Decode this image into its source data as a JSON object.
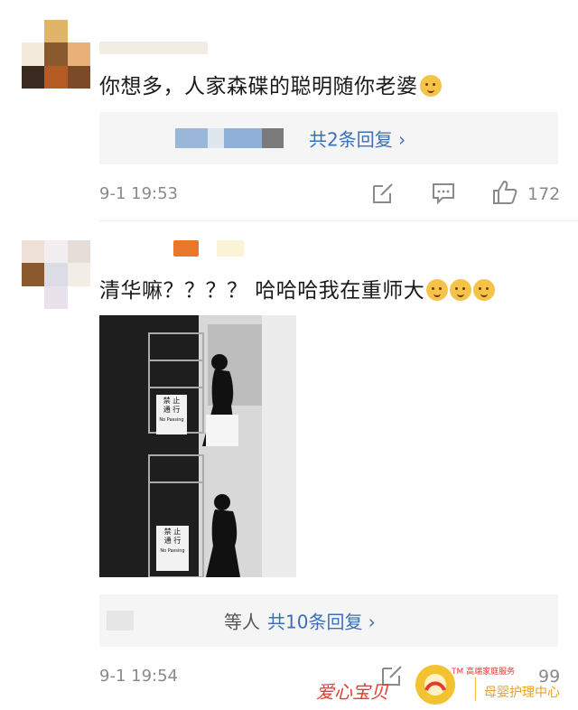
{
  "comments": [
    {
      "text": "你想多，人家森碟的聪明随你老婆",
      "replies_link": "共2条回复 ›",
      "time": "9-1 19:53",
      "like_count": "172"
    },
    {
      "text": "清华嘛？？？？ 哈哈哈我在重师大",
      "photo_signs": {
        "sign1": "禁 止\n通 行",
        "sign1_en": "No Passing"
      },
      "replies_prefix": "等人",
      "replies_link": "共10条回复 ›",
      "time": "9-1 19:54",
      "like_count": "99"
    }
  ],
  "watermark": {
    "left_text": "爱心宝贝",
    "tm_text": "TM 高端家庭服务",
    "right_text": "母婴护理中心"
  },
  "icons": {
    "comment1_emoji": "doge-face-icon",
    "share": "edit-share-icon",
    "comment": "comment-bubble-icon",
    "like": "thumbs-up-icon"
  },
  "colors": {
    "link_blue": "#3b6fb6",
    "meta_gray": "#8a8a8a",
    "reply_bg": "#f5f5f5",
    "watermark_red": "#e8392f",
    "watermark_yellow": "#f2c230"
  }
}
